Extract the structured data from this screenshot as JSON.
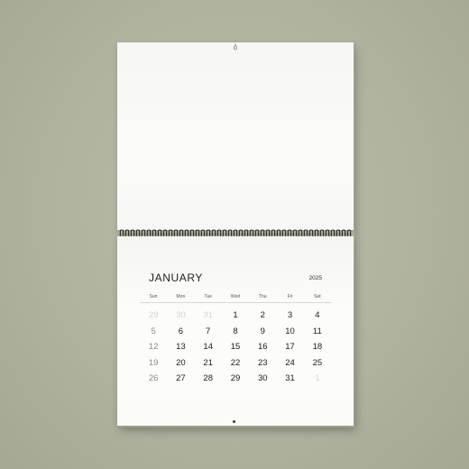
{
  "calendar": {
    "month": "JANUARY",
    "year": "2025",
    "weekdays": [
      "Sun",
      "Mon",
      "Tue",
      "Wed",
      "Thu",
      "Fri",
      "Sat"
    ],
    "weeks": [
      [
        {
          "d": "29",
          "other": true
        },
        {
          "d": "30",
          "other": true
        },
        {
          "d": "31",
          "other": true
        },
        {
          "d": "1"
        },
        {
          "d": "2"
        },
        {
          "d": "3"
        },
        {
          "d": "4"
        }
      ],
      [
        {
          "d": "5"
        },
        {
          "d": "6"
        },
        {
          "d": "7"
        },
        {
          "d": "8"
        },
        {
          "d": "9"
        },
        {
          "d": "10"
        },
        {
          "d": "11"
        }
      ],
      [
        {
          "d": "12"
        },
        {
          "d": "13"
        },
        {
          "d": "14"
        },
        {
          "d": "15"
        },
        {
          "d": "16"
        },
        {
          "d": "17"
        },
        {
          "d": "18"
        }
      ],
      [
        {
          "d": "19"
        },
        {
          "d": "20"
        },
        {
          "d": "21"
        },
        {
          "d": "22"
        },
        {
          "d": "23"
        },
        {
          "d": "24"
        },
        {
          "d": "25"
        }
      ],
      [
        {
          "d": "26"
        },
        {
          "d": "27"
        },
        {
          "d": "28"
        },
        {
          "d": "29"
        },
        {
          "d": "30"
        },
        {
          "d": "31"
        },
        {
          "d": "1",
          "other": true
        }
      ]
    ]
  },
  "colors": {
    "background": "#b0b3a0",
    "paper": "#fbfbfa",
    "ink": "#1c1c1c",
    "muted": "#d3d3d1",
    "spiral": "#2e2e2e"
  },
  "icons": {
    "hanger": "hanger-icon",
    "spiral": "spiral-binding-icon",
    "hole": "hole-icon"
  }
}
